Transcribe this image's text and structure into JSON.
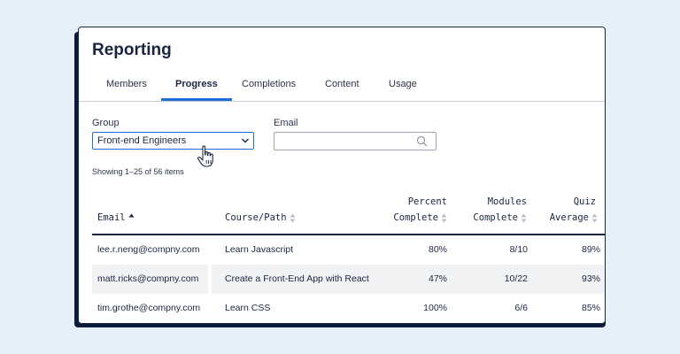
{
  "page": {
    "title": "Reporting"
  },
  "tabs": [
    {
      "label": "Members",
      "active": false
    },
    {
      "label": "Progress",
      "active": true
    },
    {
      "label": "Completions",
      "active": false
    },
    {
      "label": "Content",
      "active": false
    },
    {
      "label": "Usage",
      "active": false
    }
  ],
  "filters": {
    "group_label": "Group",
    "group_value": "Front-end Engineers",
    "email_label": "Email",
    "email_value": "",
    "email_placeholder": ""
  },
  "pagination": {
    "summary": "Showing 1–25 of 56 items"
  },
  "table": {
    "columns": [
      {
        "line1": "",
        "line2": "Email",
        "sort": "asc"
      },
      {
        "line1": "",
        "line2": "Course/Path",
        "sort": "none"
      },
      {
        "line1": "Percent",
        "line2": "Complete",
        "sort": "none"
      },
      {
        "line1": "Modules",
        "line2": "Complete",
        "sort": "none"
      },
      {
        "line1": "Quiz",
        "line2": "Average",
        "sort": "none"
      }
    ],
    "rows": [
      {
        "email": "lee.r.neng@compny.com",
        "course": "Learn Javascript",
        "percent": "80%",
        "modules": "8/10",
        "quiz": "89%"
      },
      {
        "email": "matt.ricks@compny.com",
        "course": "Create a Front-End App with React",
        "percent": "47%",
        "modules": "10/22",
        "quiz": "93%"
      },
      {
        "email": "tim.grothe@compny.com",
        "course": "Learn CSS",
        "percent": "100%",
        "modules": "6/6",
        "quiz": "85%"
      }
    ]
  },
  "colors": {
    "accent": "#1d6fd6",
    "text": "#1a2540",
    "background": "#e6f0fb"
  }
}
